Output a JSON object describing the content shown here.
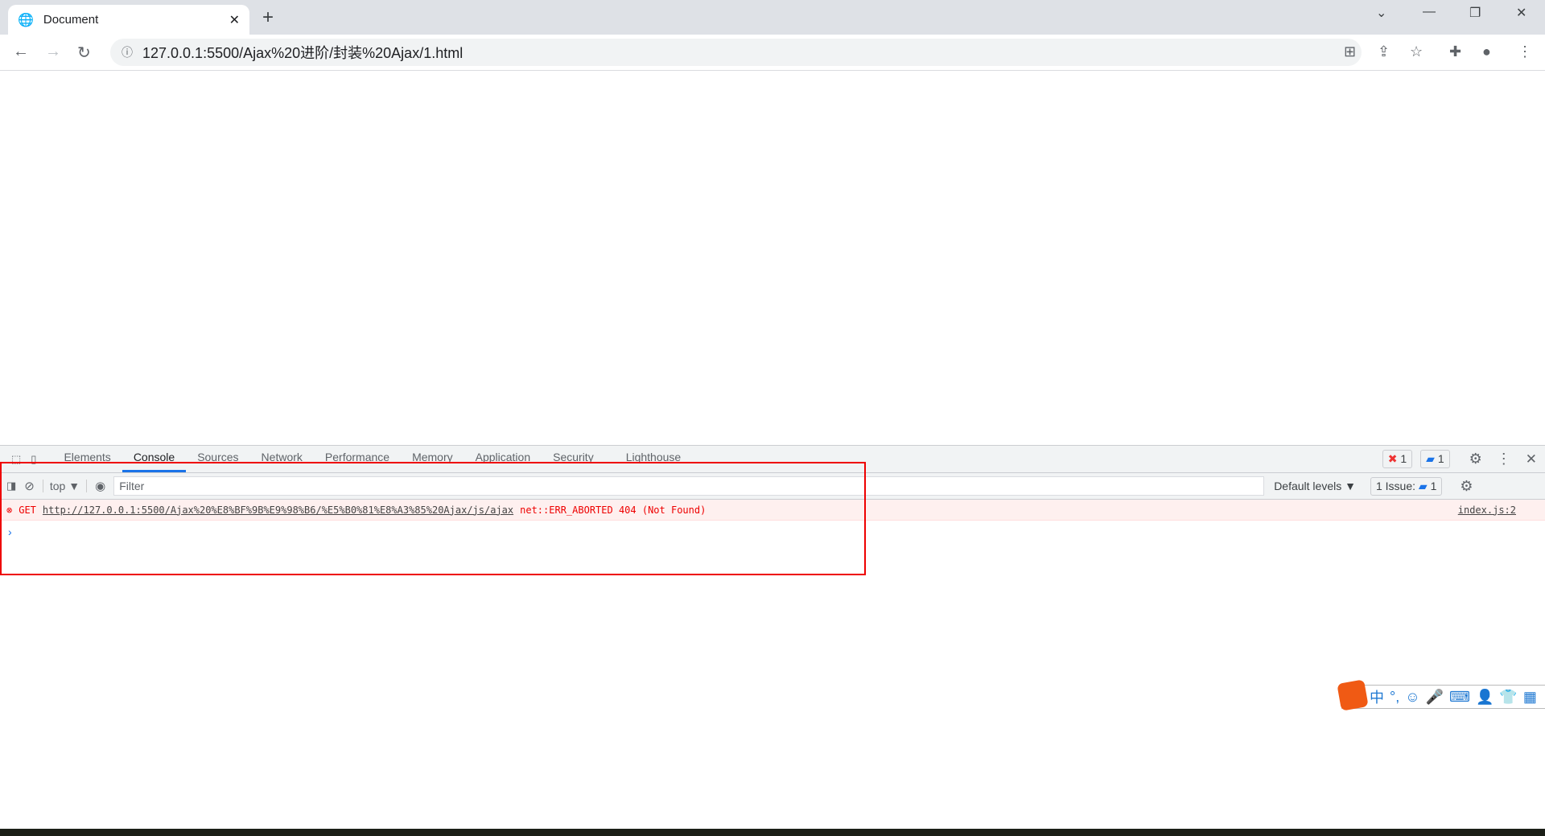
{
  "browser": {
    "tab_title": "Document",
    "url": "127.0.0.1:5500/Ajax%20进阶/封装%20Ajax/1.html"
  },
  "devtools": {
    "tabs": [
      "Elements",
      "Console",
      "Sources",
      "Network",
      "Performance",
      "Memory",
      "Application",
      "Security",
      "Lighthouse"
    ],
    "active_tab": "Console",
    "error_count": "1",
    "message_count": "1",
    "context": "top ▼",
    "filter_placeholder": "Filter",
    "levels": "Default levels ▼",
    "issues_label": "1 Issue:",
    "issues_count": "1",
    "error": {
      "method": "GET",
      "url": "http://127.0.0.1:5500/Ajax%20%E8%BF%9B%E9%98%B6/%E5%B0%81%E8%A3%85%20Ajax/js/ajax",
      "message": "net::ERR_ABORTED 404 (Not Found)",
      "source": "index.js:2"
    },
    "prompt": "›"
  },
  "ime": {
    "items": [
      "中",
      "°,",
      "☺",
      "🎤",
      "⌨",
      "👤",
      "👕",
      "▦"
    ],
    "logo": "S"
  },
  "colors": {
    "error": "#e00000",
    "accent": "#1a73e8",
    "highlight_box": "#e00000"
  }
}
